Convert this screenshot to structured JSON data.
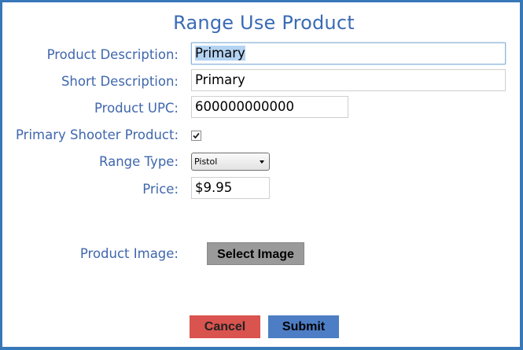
{
  "dialog": {
    "title": "Range Use Product"
  },
  "form": {
    "product_description": {
      "label": "Product Description:",
      "value": "Primary"
    },
    "short_description": {
      "label": "Short Description:",
      "value": "Primary"
    },
    "product_upc": {
      "label": "Product UPC:",
      "value": "600000000000"
    },
    "primary_shooter_product": {
      "label": "Primary Shooter Product:",
      "checked": true
    },
    "range_type": {
      "label": "Range Type:",
      "selected": "Pistol"
    },
    "price": {
      "label": "Price:",
      "value": "$9.95"
    },
    "product_image": {
      "label": "Product Image:",
      "button_label": "Select Image"
    }
  },
  "actions": {
    "cancel_label": "Cancel",
    "submit_label": "Submit"
  },
  "colors": {
    "accent": "#3a6bb4",
    "border": "#3877b8",
    "cancel": "#d9534f",
    "submit": "#4d7dc4",
    "select_image": "#9a9a9a"
  }
}
